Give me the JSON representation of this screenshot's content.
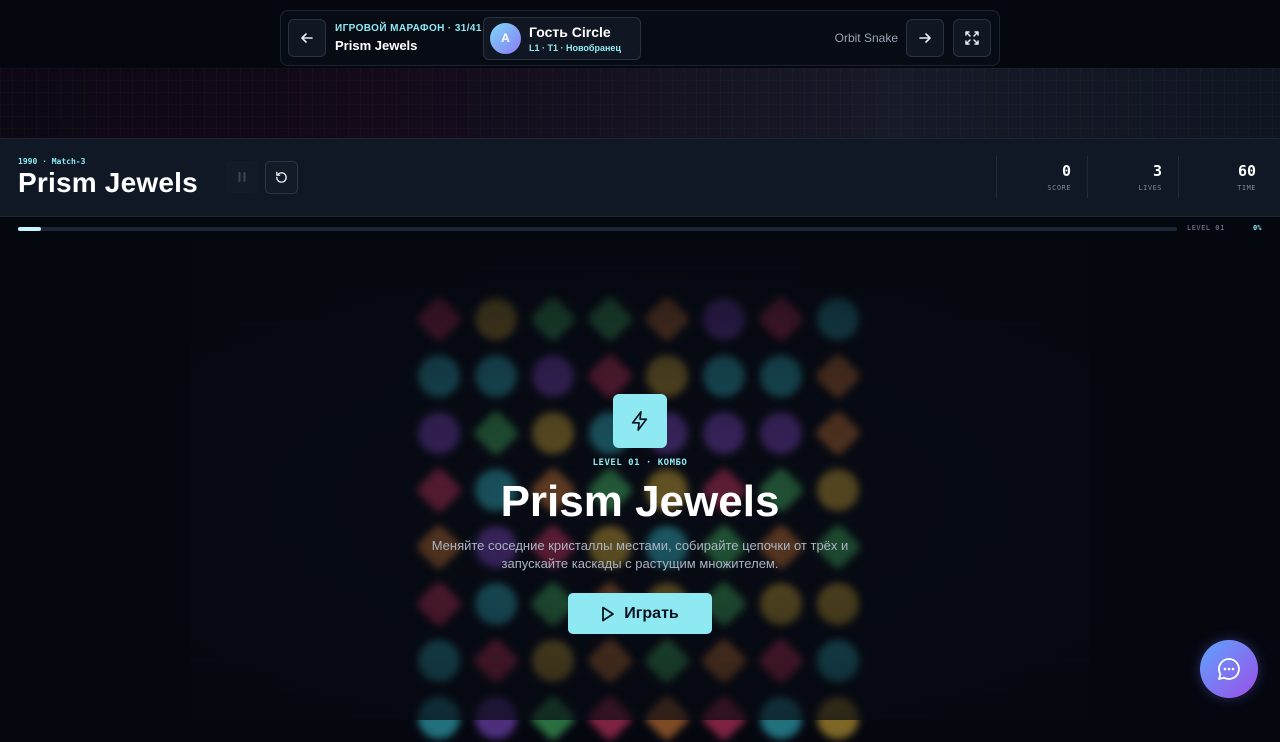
{
  "topnav": {
    "kicker": "ИГРОВОЙ МАРАФОН · 31/41",
    "title": "Prism Jewels",
    "user": {
      "initial": "A",
      "name": "Гость Circle",
      "level": "L1 · T1 · Новобранец"
    },
    "next_game": "Orbit Snake"
  },
  "game": {
    "meta": "1990 · Match-3",
    "title": "Prism Jewels",
    "stats": [
      {
        "value": "0",
        "label": "SCORE"
      },
      {
        "value": "3",
        "label": "LIVES"
      },
      {
        "value": "60",
        "label": "TIME"
      }
    ],
    "level_label": "LEVEL 01",
    "progress_percent": "0%"
  },
  "overlay": {
    "subtitle": "LEVEL 01 · КОМБО",
    "title": "Prism Jewels",
    "description": "Меняйте соседние кристаллы местами, собирайте цепочки от трёх и запускайте каскады с растущим множителем.",
    "play_label": "Играть"
  },
  "colors": {
    "accent": "#8ee9f3",
    "background": "#05070f",
    "gem_colors": [
      "#e03a6a",
      "#e0b43a",
      "#4bc46b",
      "#e0823a",
      "#8a4fd6",
      "#39c7d6"
    ]
  },
  "icons": [
    "arrow-left-icon",
    "arrow-right-icon",
    "fullscreen-icon",
    "pause-icon",
    "restart-icon",
    "lightning-icon",
    "play-icon",
    "chat-icon"
  ]
}
